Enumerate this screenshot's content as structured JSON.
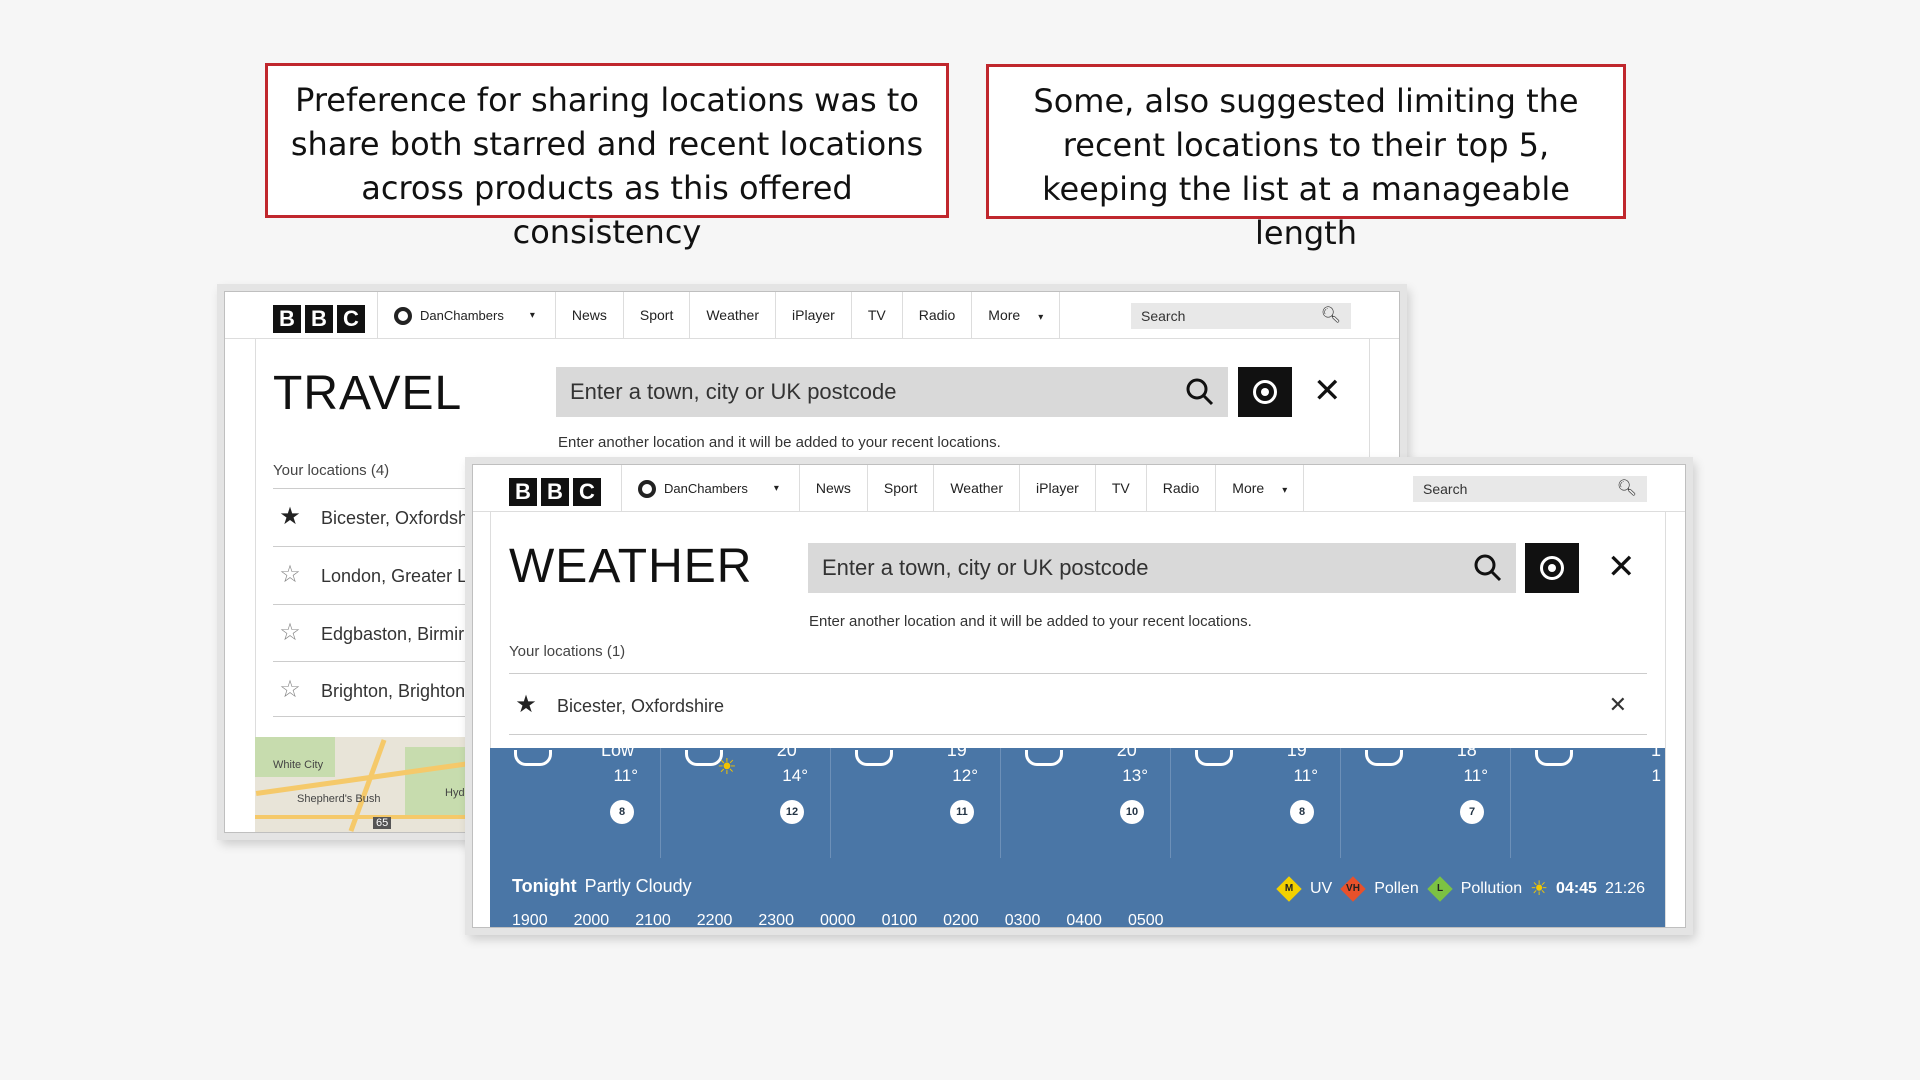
{
  "callouts": {
    "left": "Preference for sharing locations was to share both starred and recent locations across products as this offered consistency",
    "right": "Some, also suggested limiting the recent locations to their top 5, keeping the list at a manageable length"
  },
  "nav": {
    "logo": [
      "B",
      "B",
      "C"
    ],
    "user": "DanChambers",
    "items": [
      "News",
      "Sport",
      "Weather",
      "iPlayer",
      "TV",
      "Radio",
      "More"
    ],
    "search_placeholder": "Search"
  },
  "travel": {
    "title": "TRAVEL",
    "input_placeholder": "Enter a town, city or UK postcode",
    "hint": "Enter another location and it will be added to your recent locations.",
    "your_locations": "Your locations (4)",
    "locations": [
      {
        "name": "Bicester, Oxfordsh",
        "starred": true
      },
      {
        "name": "London, Greater L",
        "starred": false
      },
      {
        "name": "Edgbaston, Birmir",
        "starred": false
      },
      {
        "name": "Brighton, Brighton",
        "starred": false
      }
    ],
    "map_labels": [
      "White City",
      "Shepherd's Bush",
      "Hyde",
      "65"
    ]
  },
  "weather": {
    "title": "WEATHER",
    "input_placeholder": "Enter a town, city or UK postcode",
    "hint": "Enter another location and it will be added to your recent locations.",
    "your_locations": "Your locations (1)",
    "location": "Bicester, Oxfordshire",
    "forecast": [
      {
        "hi": "Low",
        "lo": "11°",
        "wind": "8"
      },
      {
        "hi": "20°",
        "lo": "14°",
        "wind": "12"
      },
      {
        "hi": "19°",
        "lo": "12°",
        "wind": "11"
      },
      {
        "hi": "20°",
        "lo": "13°",
        "wind": "10"
      },
      {
        "hi": "19°",
        "lo": "11°",
        "wind": "8"
      },
      {
        "hi": "18°",
        "lo": "11°",
        "wind": "7"
      },
      {
        "hi": "1",
        "lo": "1",
        "wind": ""
      }
    ],
    "tonight_label": "Tonight",
    "tonight_desc": "Partly Cloudy",
    "uv_badge": "M",
    "uv_label": "UV",
    "pollen_badge": "VH",
    "pollen_label": "Pollen",
    "pollution_badge": "L",
    "pollution_label": "Pollution",
    "sunrise": "04:45",
    "sunset": "21:26",
    "hours": [
      "1900",
      "2000",
      "2100",
      "2200",
      "2300",
      "0000",
      "0100",
      "0200",
      "0300",
      "0400",
      "0500"
    ],
    "colors": {
      "strip": "#4a76a6",
      "uv": "#f2d000",
      "pollen": "#e8512b",
      "pollution": "#7cc243"
    }
  }
}
